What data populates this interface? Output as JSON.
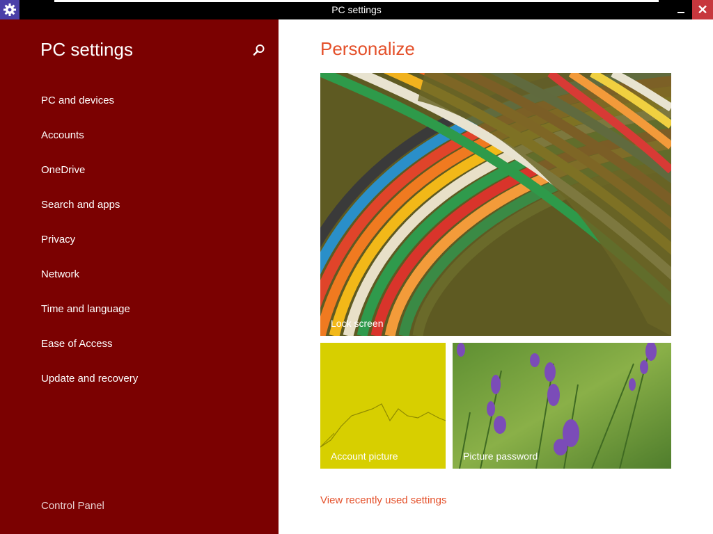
{
  "window": {
    "title": "PC settings"
  },
  "sidebar": {
    "title": "PC settings",
    "items": [
      {
        "label": "PC and devices"
      },
      {
        "label": "Accounts"
      },
      {
        "label": "OneDrive"
      },
      {
        "label": "Search and apps"
      },
      {
        "label": "Privacy"
      },
      {
        "label": "Network"
      },
      {
        "label": "Time and language"
      },
      {
        "label": "Ease of Access"
      },
      {
        "label": "Update and recovery"
      }
    ],
    "footer": "Control Panel"
  },
  "main": {
    "title": "Personalize",
    "tiles": {
      "lock_screen": "Lock screen",
      "account_picture": "Account picture",
      "picture_password": "Picture password"
    },
    "recent_link": "View recently used settings"
  },
  "icons": {
    "app": "gear-icon",
    "search": "search-icon",
    "minimize": "minimize-icon",
    "close": "close-icon"
  },
  "colors": {
    "sidebar_bg": "#7b0101",
    "accent": "#e4502a",
    "close_button": "#c7373d"
  }
}
